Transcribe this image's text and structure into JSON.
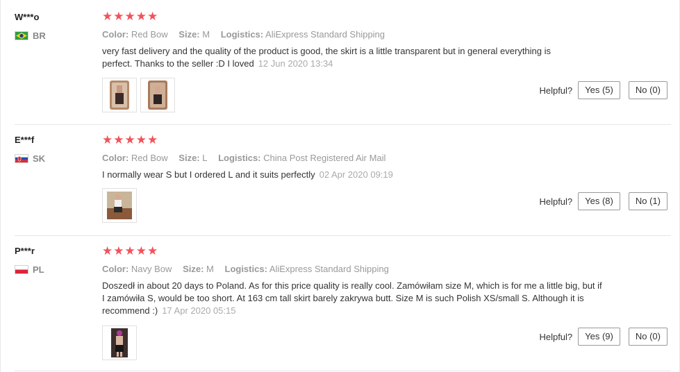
{
  "reviews": [
    {
      "buyer": "W***o",
      "country": "BR",
      "rating": "★★★★★",
      "color_label": "Color:",
      "color": "Red Bow",
      "size_label": "Size:",
      "size": "M",
      "logistics_label": "Logistics:",
      "logistics": "AliExpress Standard Shipping",
      "text": "very fast delivery and the quality of the product is good, the skirt is a little transparent but in general everything is perfect. Thanks to the seller :D I loved",
      "date": "12 Jun 2020 13:34",
      "photo_count": 2,
      "helpful_label": "Helpful?",
      "yes_label": "Yes (5)",
      "no_label": "No (0)"
    },
    {
      "buyer": "E***f",
      "country": "SK",
      "rating": "★★★★★",
      "color_label": "Color:",
      "color": "Red Bow",
      "size_label": "Size:",
      "size": "L",
      "logistics_label": "Logistics:",
      "logistics": "China Post Registered Air Mail",
      "text": "I normally wear S but I ordered L and it suits perfectly",
      "date": "02 Apr 2020 09:19",
      "photo_count": 1,
      "helpful_label": "Helpful?",
      "yes_label": "Yes (8)",
      "no_label": "No (1)"
    },
    {
      "buyer": "P***r",
      "country": "PL",
      "rating": "★★★★★",
      "color_label": "Color:",
      "color": "Navy Bow",
      "size_label": "Size:",
      "size": "M",
      "logistics_label": "Logistics:",
      "logistics": "AliExpress Standard Shipping",
      "text": "Doszedł in about 20 days to Poland. As for this price quality is really cool. Zamówiłam size M, which is for me a little big, but if I zamówiła S, would be too short. At 163 cm tall skirt barely zakrywa butt. Size M is such Polish XS/small S. Although it is recommend :)",
      "date": "17 Apr 2020 05:15",
      "photo_count": 1,
      "helpful_label": "Helpful?",
      "yes_label": "Yes (9)",
      "no_label": "No (0)"
    }
  ],
  "colors": {
    "star": "#f2525a",
    "muted": "#999999",
    "date": "#aaaaaa"
  }
}
